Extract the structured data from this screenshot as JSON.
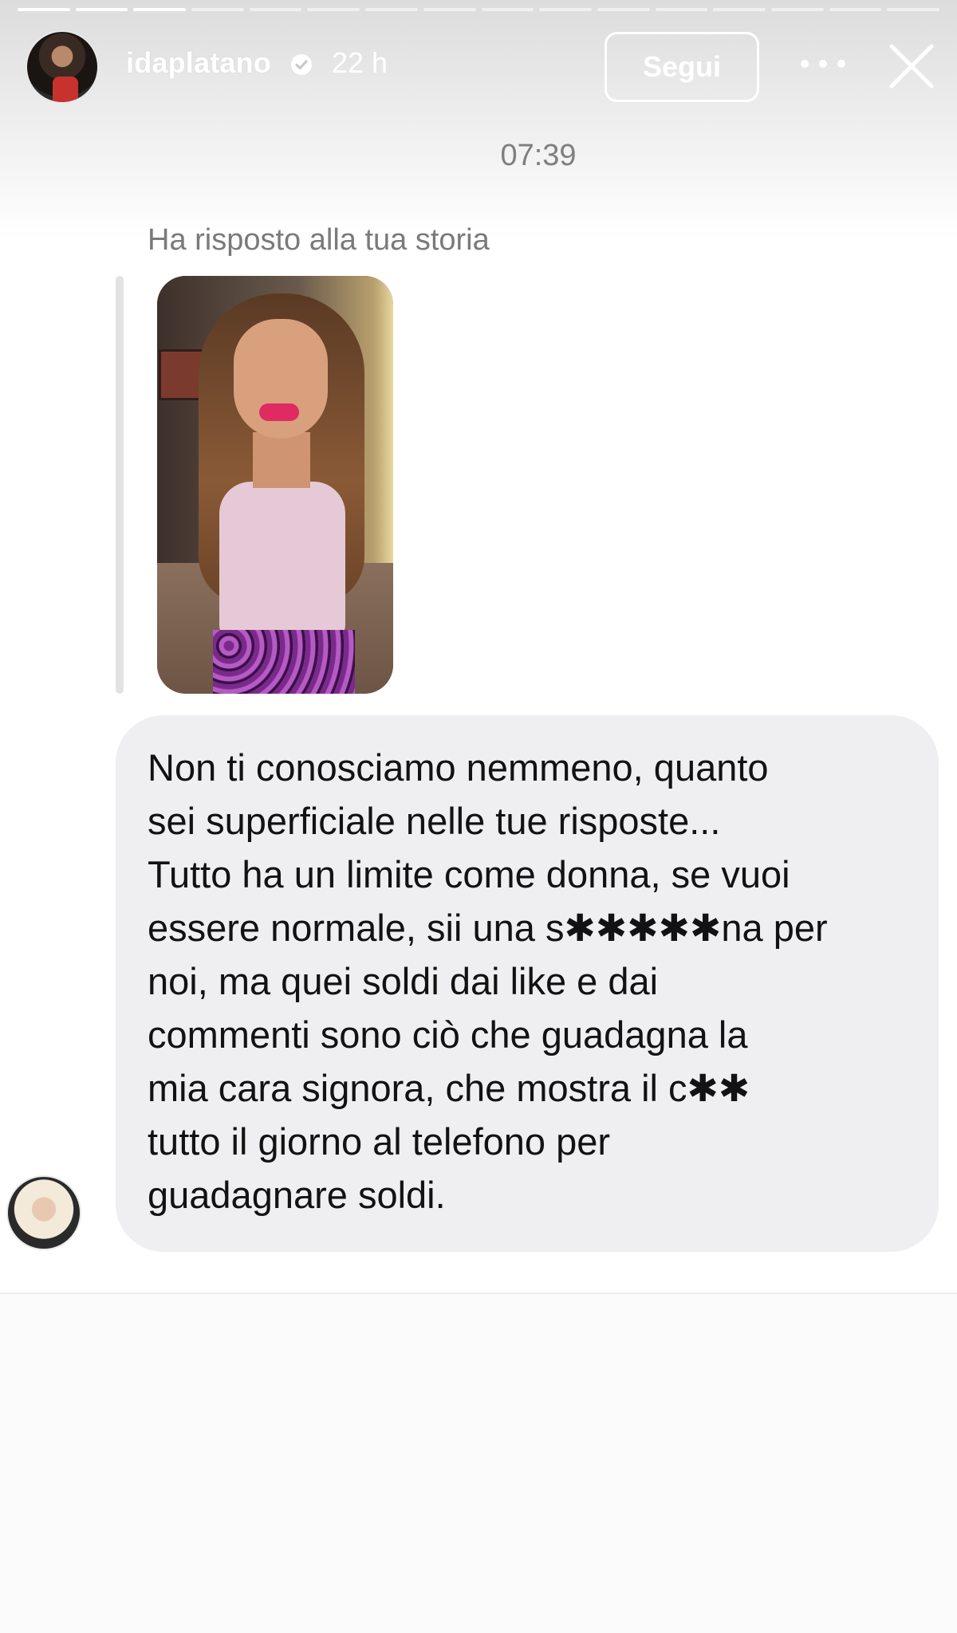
{
  "header": {
    "username": "idaplatano",
    "verified": true,
    "time_ago": "22 h",
    "follow_label": "Segui",
    "progress": {
      "segments": 16,
      "completed": 3
    }
  },
  "chat": {
    "timestamp": "07:39",
    "reply_label": "Ha risposto alla tua storia",
    "message": "Non ti conosciamo nemmeno, quanto\nsei superficiale nelle tue risposte...\nTutto ha un limite come donna, se vuoi\nessere normale, sii una s✱✱✱✱✱na per\nnoi, ma quei soldi dai like e dai\ncommenti sono ciò che guadagna la\nmia cara signora, che mostra il c✱✱\ntutto il giorno al telefono per\nguadagnare soldi."
  },
  "icons": {
    "verified": "verified-badge-icon",
    "more": "more-options-icon",
    "close": "close-icon"
  },
  "colors": {
    "bubble": "#efeff1",
    "header_text": "#ffffff",
    "muted_text": "#7f7f7f"
  }
}
